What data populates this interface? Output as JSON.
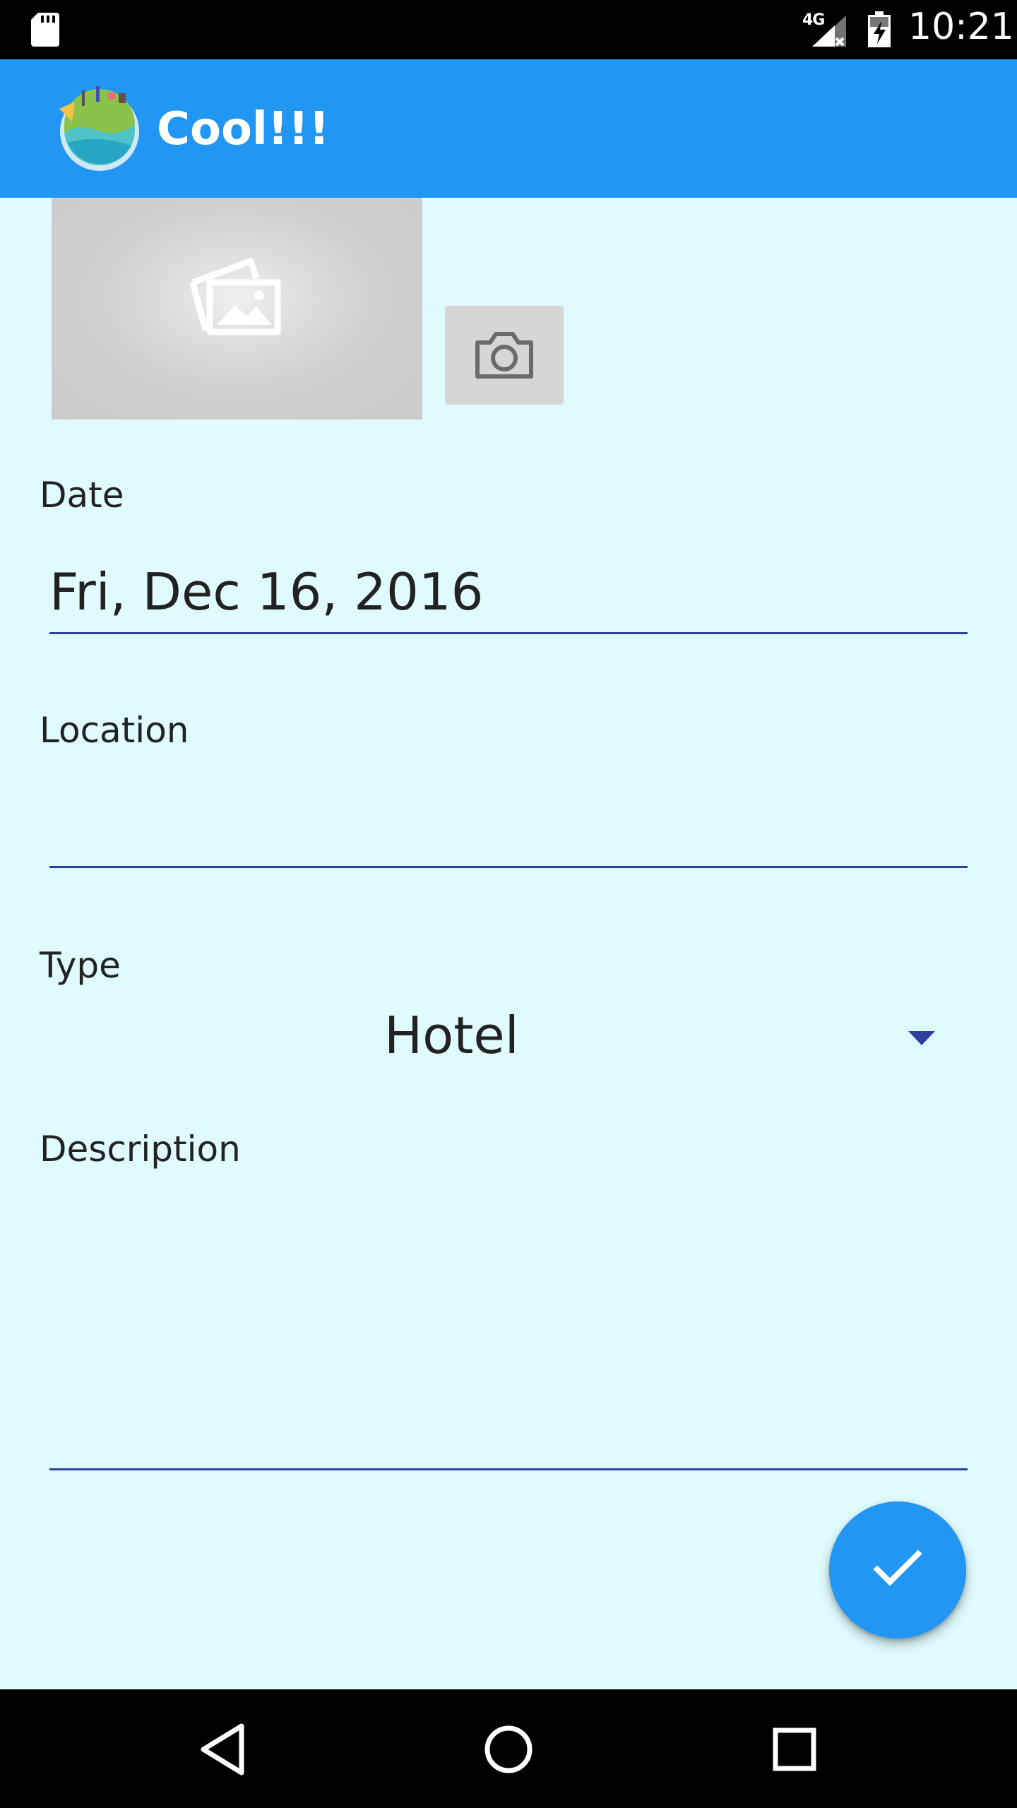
{
  "status_bar": {
    "network": "4G",
    "time": "10:21"
  },
  "app_bar": {
    "title": "Cool!!!"
  },
  "colors": {
    "primary": "#2196f3",
    "background": "#e0fbff",
    "accent_underline": "#303f9f"
  },
  "form": {
    "date_label": "Date",
    "date_value": "Fri, Dec 16, 2016",
    "location_label": "Location",
    "location_value": "",
    "type_label": "Type",
    "type_value": "Hotel",
    "description_label": "Description",
    "description_value": ""
  },
  "icons": {
    "photo": "image-placeholder-icon",
    "camera": "camera-icon",
    "fab": "check-icon",
    "nav_back": "back-triangle-icon",
    "nav_home": "home-circle-icon",
    "nav_recents": "recents-square-icon"
  }
}
